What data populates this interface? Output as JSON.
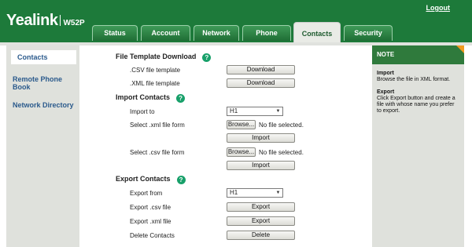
{
  "brand": {
    "name": "Yealink",
    "model": "W52P"
  },
  "header": {
    "logout": "Logout"
  },
  "tabs": [
    {
      "label": "Status"
    },
    {
      "label": "Account"
    },
    {
      "label": "Network"
    },
    {
      "label": "Phone"
    },
    {
      "label": "Contacts",
      "active": true
    },
    {
      "label": "Security"
    }
  ],
  "sidebar": {
    "items": [
      {
        "label": "Contacts",
        "active": true
      },
      {
        "label": "Remote Phone Book"
      },
      {
        "label": "Network Directory"
      }
    ]
  },
  "main": {
    "template": {
      "title": "File Template Download",
      "csv_label": ".CSV file template",
      "csv_button": "Download",
      "xml_label": ".XML file template",
      "xml_button": "Download"
    },
    "import": {
      "title": "Import Contacts",
      "import_to_label": "Import to",
      "import_to_value": "H1",
      "xml_label": "Select .xml file form",
      "browse": "Browse...",
      "no_file": "No file selected.",
      "import_button": "Import",
      "csv_label": "Select .csv file form"
    },
    "export": {
      "title": "Export Contacts",
      "export_from_label": "Export from",
      "export_from_value": "H1",
      "csv_label": "Export .csv file",
      "xml_label": "Export .xml file",
      "delete_label": "Delete Contacts",
      "export_button": "Export",
      "delete_button": "Delete"
    },
    "help_glyph": "?"
  },
  "note": {
    "heading": "NOTE",
    "import_title": "Import",
    "import_text": "Browse the file in XML format.",
    "export_title": "Export",
    "export_text": "Click Export button and create a file with whose name you prefer to export."
  },
  "colors": {
    "header_green": "#1d7a3a",
    "note_accent": "#f29a1f",
    "help_icon": "#18a06a",
    "link_blue": "#2b5a8c"
  }
}
